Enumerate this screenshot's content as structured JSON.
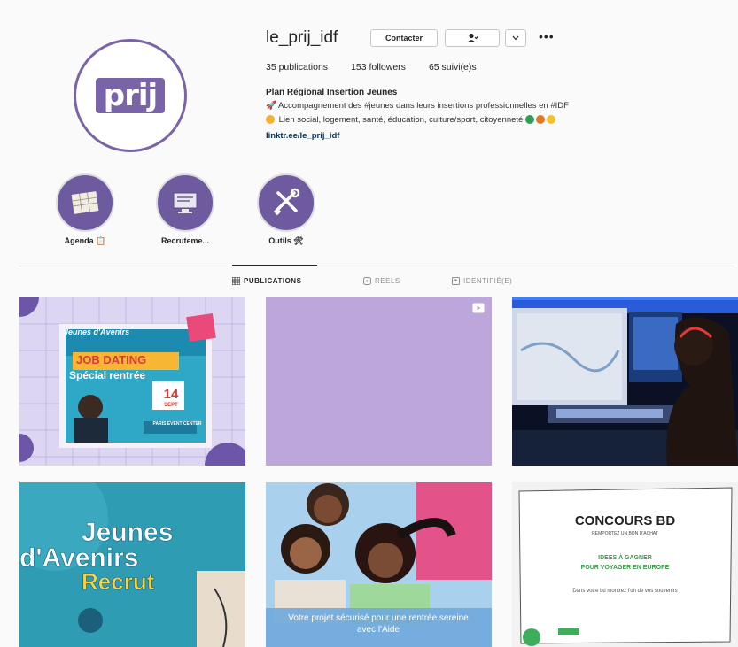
{
  "profile": {
    "avatar_text": "prij",
    "username": "le_prij_idf",
    "contact_label": "Contacter",
    "more_dots": "•••",
    "stats": {
      "publications": "35 publications",
      "followers": "153 followers",
      "following": "65 suivi(e)s"
    },
    "bio_name": "Plan Régional Insertion Jeunes",
    "bio_line1": "Accompagnement des #jeunes dans leurs insertions professionnelles en #IDF",
    "bio_line2": "Lien social, logement, santé, éducation, culture/sport, citoyenneté",
    "bio_link": "linktr.ee/le_prij_idf"
  },
  "highlights": [
    {
      "label": "Agenda 📋"
    },
    {
      "label": "Recruteme..."
    },
    {
      "label": "Outils 🛠"
    }
  ],
  "tabs": {
    "publications": "PUBLICATIONS",
    "reels": "REELS",
    "tagged": "IDENTIFIÉ(E)"
  },
  "posts": {
    "p1": {
      "line1": "Jeunes d'Avenirs",
      "line2": "JOB DATING",
      "line3": "Spécial rentrée",
      "day": "14",
      "month": "SEPT",
      "place": "PARIS EVENT CENTER"
    },
    "p4": {
      "line1": "Jeunes",
      "line2": "d'Avenirs",
      "line3": "Recrut"
    },
    "p5": {
      "caption": "Votre projet sécurisé pour une rentrée sereine avec l'Aide"
    },
    "p6": {
      "title": "CONCOURS BD",
      "subtitle": "REMPORTEZ UN BON D'ACHAT",
      "green1": "IDEES À GAGNER",
      "green2": "POUR VOYAGER EN EUROPE",
      "body": "Dans votre bd montrez l'un de vos souvenirs"
    }
  },
  "colors": {
    "accent": "#7a64a8",
    "highlight": "#6e5a9e"
  }
}
